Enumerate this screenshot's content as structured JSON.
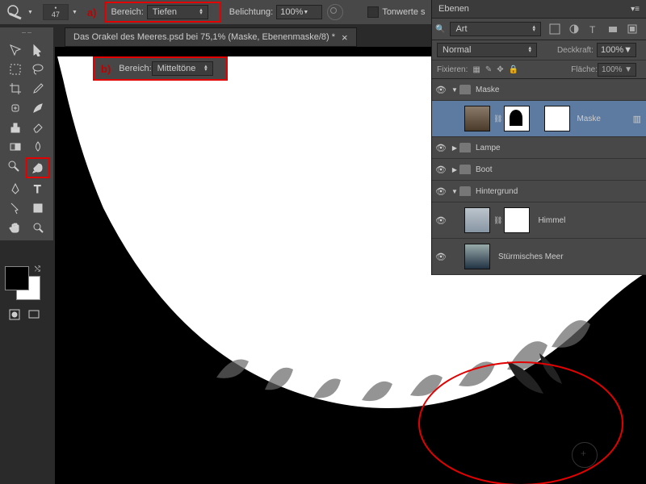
{
  "topbar": {
    "brush_size": "47",
    "marker_a": "a)",
    "range_label": "Bereich:",
    "range_value_a": "Tiefen",
    "exposure_label": "Belichtung:",
    "exposure_value": "100%",
    "tone_label": "Tonwerte s"
  },
  "floatbar": {
    "marker_b": "b)",
    "range_label": "Bereich:",
    "range_value_b": "Mitteltöne"
  },
  "tab": {
    "title": "Das Orakel des Meeres.psd bei 75,1% (Maske, Ebenenmaske/8) *",
    "close": "×"
  },
  "layers": {
    "panel_title": "Ebenen",
    "kind_label": "Art",
    "blend_mode": "Normal",
    "opacity_label": "Deckkraft:",
    "opacity_value": "100%",
    "lock_label": "Fixieren:",
    "fill_label": "Fläche:",
    "fill_value": "100%",
    "items": [
      {
        "name": "Maske",
        "type": "group",
        "open": true
      },
      {
        "name": "Maske",
        "type": "layer",
        "selected": true,
        "indent": 1
      },
      {
        "name": "Lampe",
        "type": "group",
        "open": false
      },
      {
        "name": "Boot",
        "type": "group",
        "open": false
      },
      {
        "name": "Hintergrund",
        "type": "group",
        "open": true
      },
      {
        "name": "Himmel",
        "type": "layer",
        "indent": 1
      },
      {
        "name": "Stürmisches Meer",
        "type": "layer",
        "indent": 1
      }
    ]
  }
}
